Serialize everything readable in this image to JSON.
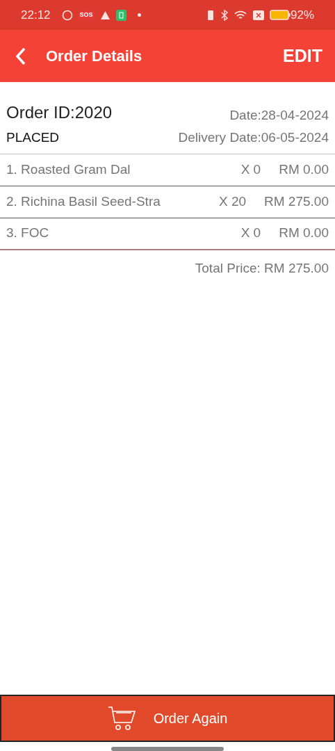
{
  "status_bar": {
    "time": "22:12",
    "sos_badge": "SOS",
    "battery": "92%"
  },
  "app_bar": {
    "title": "Order Details",
    "action": "EDIT"
  },
  "order": {
    "id": "Order ID:2020",
    "status": "PLACED",
    "date": "Date:28-04-2024",
    "delivery_date": "Delivery Date:06-05-2024"
  },
  "items": [
    {
      "name": "1. Roasted Gram Dal",
      "quantity": "X 0",
      "price": "RM 0.00"
    },
    {
      "name": "2. Richina Basil Seed-Stra",
      "quantity": "X 20",
      "price": "RM 275.00"
    },
    {
      "name": "3. FOC",
      "quantity": "X 0",
      "price": "RM 0.00"
    }
  ],
  "total": "Total Price: RM 275.00",
  "bottom_button": "Order Again"
}
